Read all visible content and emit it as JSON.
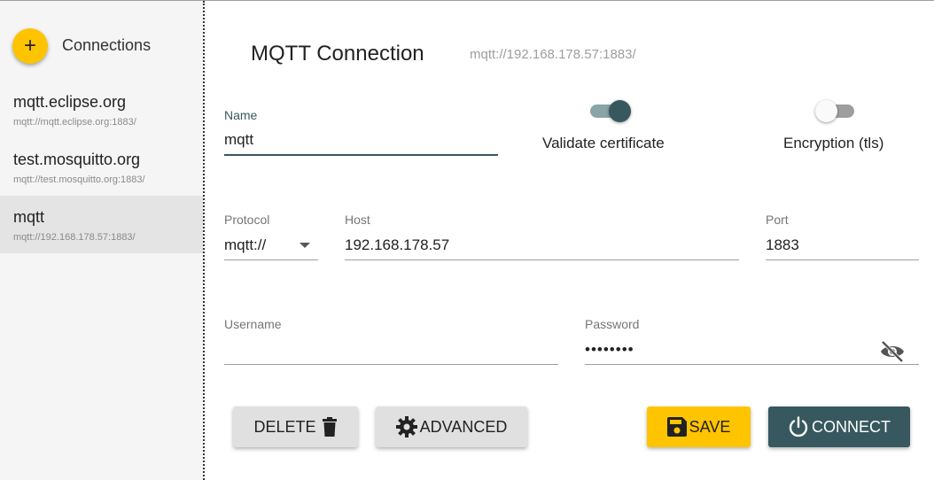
{
  "sidebar": {
    "title": "Connections",
    "add_label": "+",
    "items": [
      {
        "name": "mqtt.eclipse.org",
        "url": "mqtt://mqtt.eclipse.org:1883/"
      },
      {
        "name": "test.mosquitto.org",
        "url": "mqtt://test.mosquitto.org:1883/"
      },
      {
        "name": "mqtt",
        "url": "mqtt://192.168.178.57:1883/"
      }
    ]
  },
  "header": {
    "title": "MQTT Connection",
    "url": "mqtt://192.168.178.57:1883/"
  },
  "form": {
    "name_label": "Name",
    "name_value": "mqtt",
    "validate_label": "Validate certificate",
    "validate_on": true,
    "encryption_label": "Encryption (tls)",
    "encryption_on": false,
    "protocol_label": "Protocol",
    "protocol_value": "mqtt://",
    "host_label": "Host",
    "host_value": "192.168.178.57",
    "port_label": "Port",
    "port_value": "1883",
    "username_label": "Username",
    "username_value": "",
    "password_label": "Password",
    "password_value": "••••••••"
  },
  "buttons": {
    "delete": "DELETE",
    "advanced": "ADVANCED",
    "save": "SAVE",
    "connect": "CONNECT"
  },
  "colors": {
    "accent_yellow": "#ffc400",
    "primary_teal": "#37585f",
    "sidebar_bg": "#f5f5f5",
    "active_item_bg": "#e4e4e4"
  },
  "icons": {
    "add": "plus-icon",
    "delete": "trash-icon",
    "advanced": "gear-icon",
    "save": "floppy-icon",
    "connect": "power-icon",
    "password_visibility": "eye-off-icon"
  }
}
